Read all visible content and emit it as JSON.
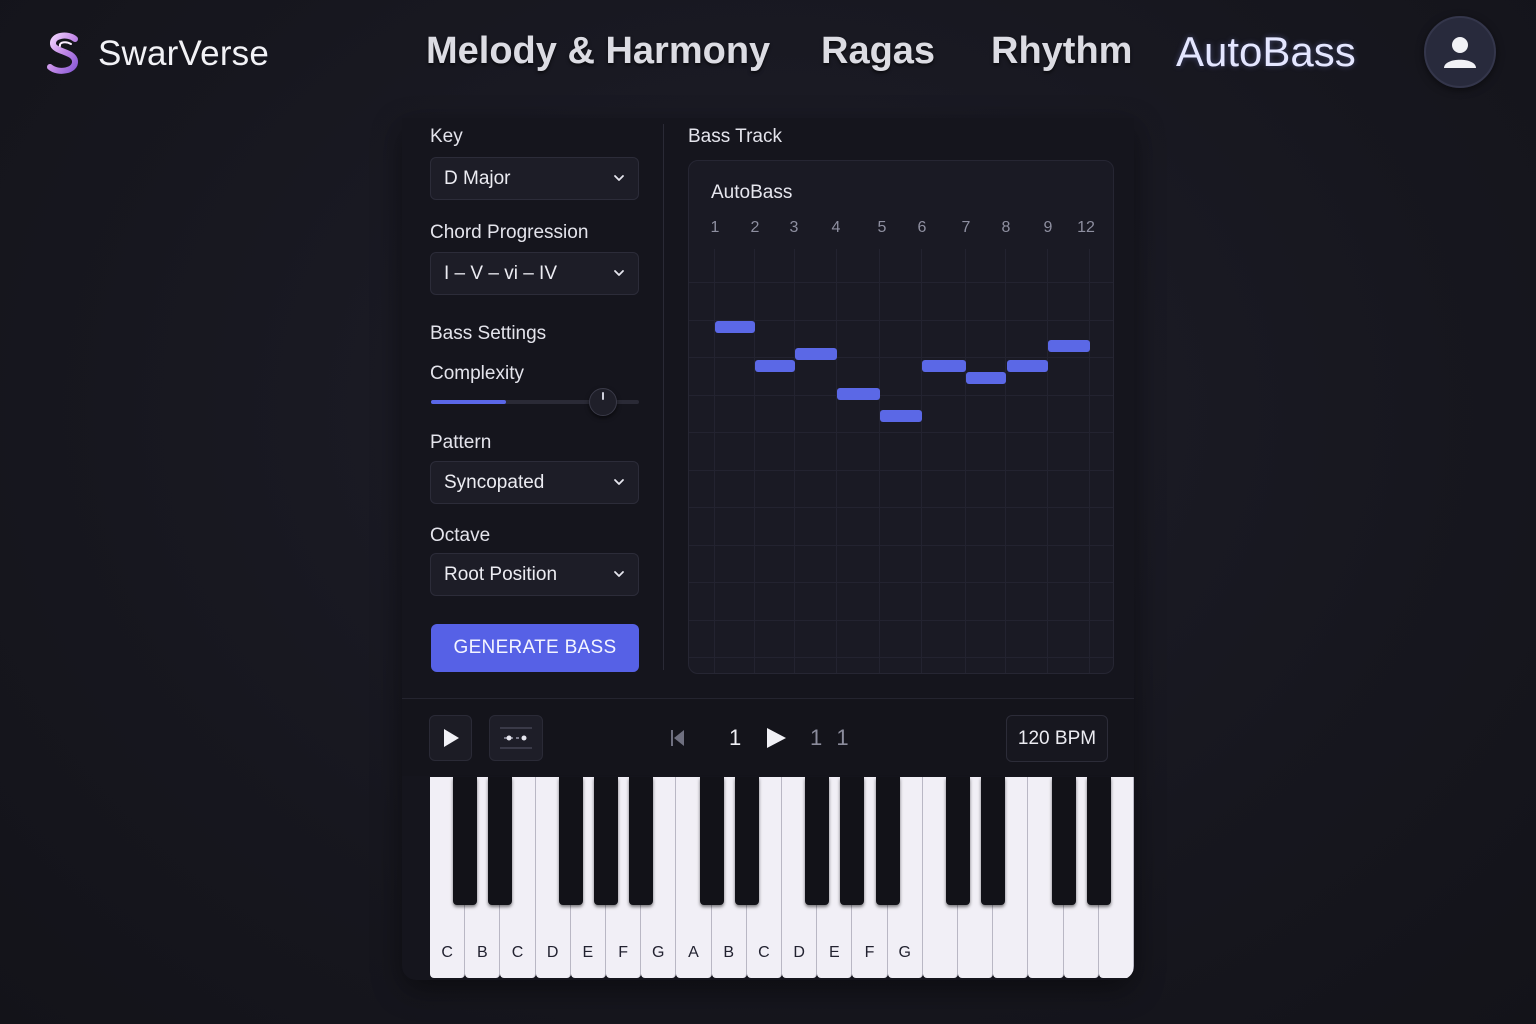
{
  "brand": {
    "name": "SwarVerse",
    "logo_icon": "swarverse-s-logo-icon"
  },
  "nav": {
    "items": [
      {
        "label": "Melody & Harmony",
        "active": false
      },
      {
        "label": "Ragas",
        "active": false
      },
      {
        "label": "Rhythm",
        "active": false
      },
      {
        "label": "AutoBass",
        "active": true
      }
    ],
    "avatar_icon": "user-icon"
  },
  "settings": {
    "key": {
      "label": "Key",
      "value": "D Major"
    },
    "chord_progression": {
      "label": "Chord Progression",
      "value": "I – V – vi – IV"
    },
    "bass_settings_title": "Bass Settings",
    "complexity": {
      "label": "Complexity",
      "fill_fraction": 0.36
    },
    "pattern": {
      "label": "Pattern",
      "value": "Syncopated"
    },
    "octave": {
      "label": "Octave",
      "value": "Root Position"
    },
    "generate_label": "GENERATE BASS"
  },
  "track": {
    "title": "Bass Track",
    "box_title": "AutoBass",
    "beats": [
      "1",
      "2",
      "3",
      "4",
      "5",
      "6",
      "7",
      "8",
      "9",
      "12"
    ]
  },
  "transport": {
    "current_bar": "1",
    "total": "1 1",
    "tempo": "120 BPM"
  },
  "piano": {
    "white_keys": [
      "C",
      "B",
      "C",
      "D",
      "E",
      "F",
      "G",
      "A",
      "B",
      "C",
      "D",
      "E",
      "F",
      "G",
      "",
      "",
      "",
      "",
      "",
      ""
    ]
  },
  "colors": {
    "accent": "#5661e6",
    "background": "#17171f",
    "panel": "#15151d"
  }
}
